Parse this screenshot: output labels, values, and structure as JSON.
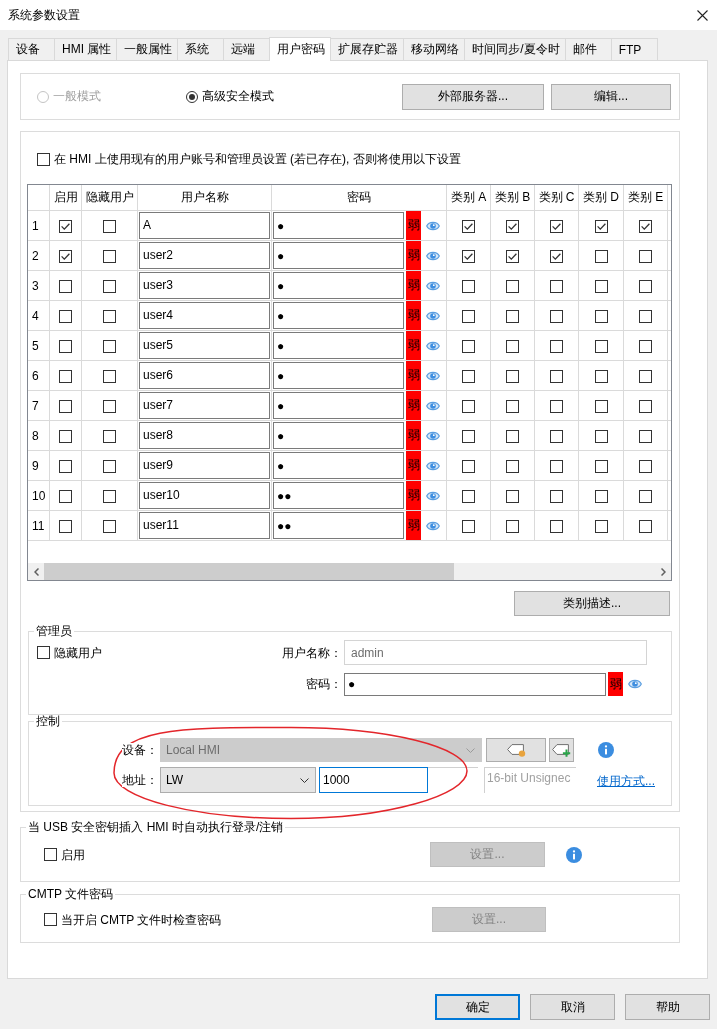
{
  "window": {
    "title": "系统参数设置"
  },
  "tabs": [
    {
      "label": "设备",
      "selected": false
    },
    {
      "label": "HMI 属性",
      "selected": false
    },
    {
      "label": "一般属性",
      "selected": false
    },
    {
      "label": "系统",
      "selected": false
    },
    {
      "label": "远端",
      "selected": false
    },
    {
      "label": "用户密码",
      "selected": true
    },
    {
      "label": "扩展存贮器",
      "selected": false
    },
    {
      "label": "移动网络",
      "selected": false
    },
    {
      "label": "时间同步/夏令时",
      "selected": false
    },
    {
      "label": "邮件",
      "selected": false
    },
    {
      "label": "FTP",
      "selected": false
    }
  ],
  "mode": {
    "options": [
      {
        "label": "一般模式",
        "selected": false,
        "disabled": true
      },
      {
        "label": "高级安全模式",
        "selected": true,
        "disabled": false
      }
    ],
    "buttons": [
      "外部服务器...",
      "编辑..."
    ]
  },
  "use_existing": {
    "label": "在 HMI 上使用现有的用户账号和管理员设置 (若已存在), 否则将使用以下设置",
    "checked": false
  },
  "users_table": {
    "columns": [
      "启用",
      "隐藏用户",
      "用户名称",
      "密码",
      "类别 A",
      "类别 B",
      "类别 C",
      "类别 D",
      "类别 E"
    ],
    "rows": [
      {
        "number": "1",
        "enabled": true,
        "hidden": false,
        "username": "A",
        "password": "●",
        "strength": "弱",
        "categories": [
          true,
          true,
          true,
          true,
          true
        ]
      },
      {
        "number": "2",
        "enabled": true,
        "hidden": false,
        "username": "user2",
        "password": "●",
        "strength": "弱",
        "categories": [
          true,
          true,
          true,
          false,
          false
        ]
      },
      {
        "number": "3",
        "enabled": false,
        "hidden": false,
        "username": "user3",
        "password": "●",
        "strength": "弱",
        "categories": [
          false,
          false,
          false,
          false,
          false
        ]
      },
      {
        "number": "4",
        "enabled": false,
        "hidden": false,
        "username": "user4",
        "password": "●",
        "strength": "弱",
        "categories": [
          false,
          false,
          false,
          false,
          false
        ]
      },
      {
        "number": "5",
        "enabled": false,
        "hidden": false,
        "username": "user5",
        "password": "●",
        "strength": "弱",
        "categories": [
          false,
          false,
          false,
          false,
          false
        ]
      },
      {
        "number": "6",
        "enabled": false,
        "hidden": false,
        "username": "user6",
        "password": "●",
        "strength": "弱",
        "categories": [
          false,
          false,
          false,
          false,
          false
        ]
      },
      {
        "number": "7",
        "enabled": false,
        "hidden": false,
        "username": "user7",
        "password": "●",
        "strength": "弱",
        "categories": [
          false,
          false,
          false,
          false,
          false
        ]
      },
      {
        "number": "8",
        "enabled": false,
        "hidden": false,
        "username": "user8",
        "password": "●",
        "strength": "弱",
        "categories": [
          false,
          false,
          false,
          false,
          false
        ]
      },
      {
        "number": "9",
        "enabled": false,
        "hidden": false,
        "username": "user9",
        "password": "●",
        "strength": "弱",
        "categories": [
          false,
          false,
          false,
          false,
          false
        ]
      },
      {
        "number": "10",
        "enabled": false,
        "hidden": false,
        "username": "user10",
        "password": "●●",
        "strength": "弱",
        "categories": [
          false,
          false,
          false,
          false,
          false
        ]
      },
      {
        "number": "11",
        "enabled": false,
        "hidden": false,
        "username": "user11",
        "password": "●●",
        "strength": "弱",
        "categories": [
          false,
          false,
          false,
          false,
          false
        ]
      }
    ]
  },
  "category_button": "类别描述...",
  "admin": {
    "title": "管理员",
    "hide_user": {
      "label": "隐藏用户",
      "checked": false
    },
    "username": {
      "label": "用户名称：",
      "value": "admin",
      "disabled": true
    },
    "password": {
      "label": "密码：",
      "value": "●",
      "strength": "弱"
    }
  },
  "control": {
    "title": "控制",
    "device": {
      "label": "设备：",
      "value": "Local HMI",
      "disabled": true
    },
    "address": {
      "label": "地址：",
      "type": "LW",
      "value": "1000",
      "focused": true
    },
    "data_type": {
      "value": "16-bit Unsignec",
      "disabled": true
    },
    "help_link": "使用方式..."
  },
  "usb_key": {
    "title": "当 USB 安全密钥插入 HMI 时自动执行登录/注销",
    "enable": {
      "label": "启用",
      "checked": false
    },
    "button": {
      "label": "设置...",
      "disabled": true
    }
  },
  "cmtp": {
    "title": "CMTP 文件密码",
    "check": {
      "label": "当开启 CMTP 文件时检查密码",
      "checked": false
    },
    "button": {
      "label": "设置...",
      "disabled": true
    }
  },
  "footer_buttons": [
    {
      "label": "确定",
      "default": true
    },
    {
      "label": "取消",
      "default": false
    },
    {
      "label": "帮助",
      "default": false
    }
  ]
}
